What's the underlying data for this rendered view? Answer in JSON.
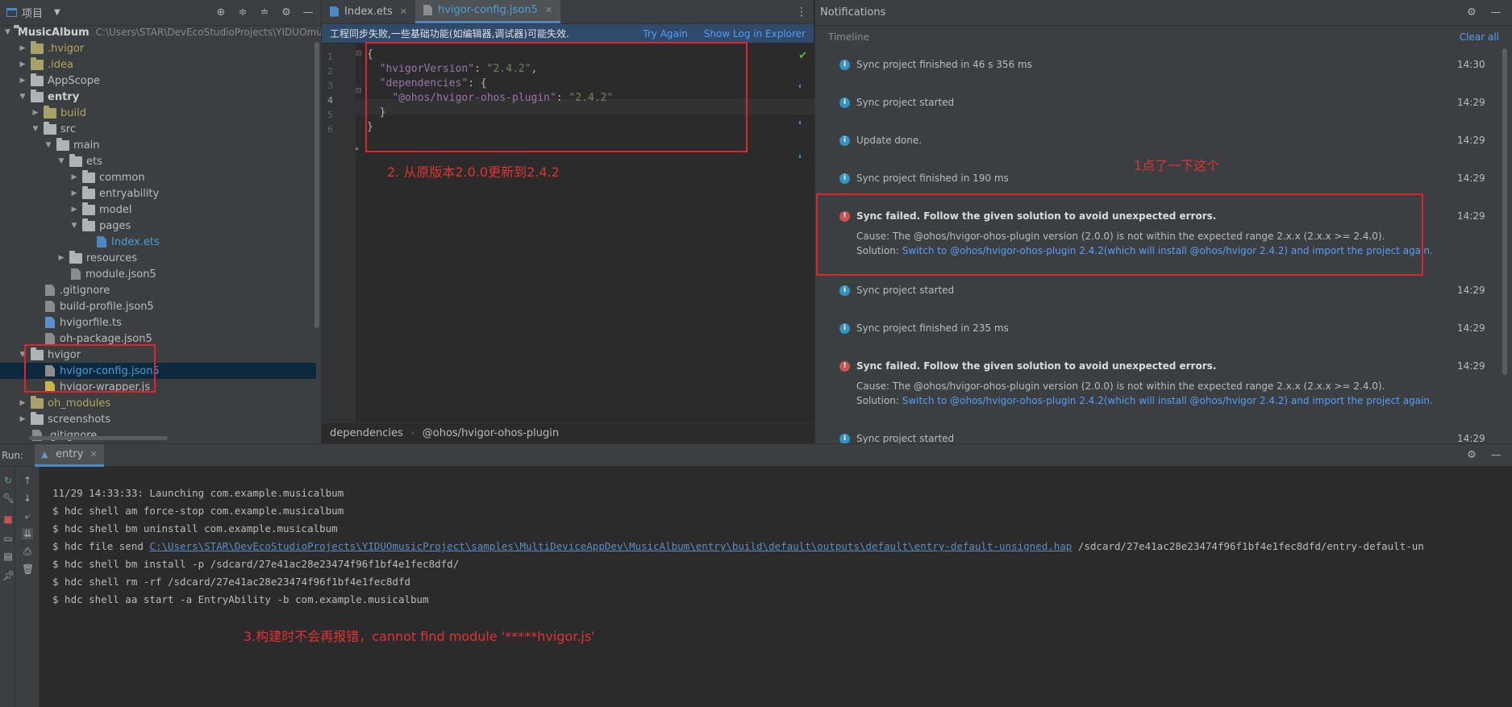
{
  "project": {
    "title": "项目",
    "tree": [
      {
        "label": "MusicAlbum",
        "path": "C:\\Users\\STAR\\DevEcoStudioProjects\\YIDUOmu",
        "indent": 0,
        "arrow": "open",
        "kind": "folder",
        "bold": true
      },
      {
        "label": ".hvigor",
        "indent": 1,
        "arrow": "closed",
        "kind": "folder-yel",
        "color": "yel"
      },
      {
        "label": ".idea",
        "indent": 1,
        "arrow": "closed",
        "kind": "folder-yel",
        "color": "yel"
      },
      {
        "label": "AppScope",
        "indent": 1,
        "arrow": "closed",
        "kind": "folder"
      },
      {
        "label": "entry",
        "indent": 1,
        "arrow": "open",
        "kind": "folder",
        "bold": true
      },
      {
        "label": "build",
        "indent": 2,
        "arrow": "closed",
        "kind": "folder-yel",
        "color": "yel"
      },
      {
        "label": "src",
        "indent": 2,
        "arrow": "open",
        "kind": "folder"
      },
      {
        "label": "main",
        "indent": 3,
        "arrow": "open",
        "kind": "folder"
      },
      {
        "label": "ets",
        "indent": 4,
        "arrow": "open",
        "kind": "folder"
      },
      {
        "label": "common",
        "indent": 5,
        "arrow": "closed",
        "kind": "folder"
      },
      {
        "label": "entryability",
        "indent": 5,
        "arrow": "closed",
        "kind": "folder"
      },
      {
        "label": "model",
        "indent": 5,
        "arrow": "closed",
        "kind": "folder"
      },
      {
        "label": "pages",
        "indent": 5,
        "arrow": "open",
        "kind": "folder"
      },
      {
        "label": "Index.ets",
        "indent": 6,
        "arrow": "none",
        "kind": "file-ets",
        "color": "blue"
      },
      {
        "label": "resources",
        "indent": 4,
        "arrow": "closed",
        "kind": "folder"
      },
      {
        "label": "module.json5",
        "indent": 4,
        "arrow": "none",
        "kind": "file"
      },
      {
        "label": ".gitignore",
        "indent": 2,
        "arrow": "none",
        "kind": "file"
      },
      {
        "label": "build-profile.json5",
        "indent": 2,
        "arrow": "none",
        "kind": "file"
      },
      {
        "label": "hvigorfile.ts",
        "indent": 2,
        "arrow": "none",
        "kind": "file-ts"
      },
      {
        "label": "oh-package.json5",
        "indent": 2,
        "arrow": "none",
        "kind": "file"
      },
      {
        "label": "hvigor",
        "indent": 1,
        "arrow": "open",
        "kind": "folder"
      },
      {
        "label": "hvigor-config.json5",
        "indent": 2,
        "arrow": "none",
        "kind": "file",
        "color": "blue",
        "selected": true
      },
      {
        "label": "hvigor-wrapper.js",
        "indent": 2,
        "arrow": "none",
        "kind": "file-js"
      },
      {
        "label": "oh_modules",
        "indent": 1,
        "arrow": "closed",
        "kind": "folder-yel",
        "color": "yel"
      },
      {
        "label": "screenshots",
        "indent": 1,
        "arrow": "closed",
        "kind": "folder"
      },
      {
        "label": ".gitignore",
        "indent": 1,
        "arrow": "none",
        "kind": "file"
      }
    ]
  },
  "editor": {
    "tabs": [
      {
        "label": "Index.ets",
        "active": false,
        "icon": "ets-file-icon"
      },
      {
        "label": "hvigor-config.json5",
        "active": true,
        "icon": "json-file-icon"
      }
    ],
    "banner": {
      "message": "工程同步失败,一些基础功能(如编辑器,调试器)可能失效.",
      "try_again": "Try Again",
      "show_log": "Show Log in Explorer"
    },
    "line_numbers": [
      "1",
      "2",
      "3",
      "4",
      "5",
      "6"
    ],
    "code": [
      {
        "parts": [
          {
            "t": "{",
            "c": "brace"
          }
        ]
      },
      {
        "parts": [
          {
            "t": "  ",
            "c": ""
          },
          {
            "t": "\"hvigorVersion\"",
            "c": "k"
          },
          {
            "t": ": ",
            "c": ""
          },
          {
            "t": "\"2.4.2\"",
            "c": "s"
          },
          {
            "t": ",",
            "c": ""
          }
        ]
      },
      {
        "parts": [
          {
            "t": "  ",
            "c": ""
          },
          {
            "t": "\"dependencies\"",
            "c": "k"
          },
          {
            "t": ": {",
            "c": ""
          }
        ]
      },
      {
        "parts": [
          {
            "t": "    ",
            "c": ""
          },
          {
            "t": "\"@ohos/hvigor-ohos-plugin\"",
            "c": "k"
          },
          {
            "t": ": ",
            "c": ""
          },
          {
            "t": "\"2.4.2\"",
            "c": "s"
          }
        ]
      },
      {
        "parts": [
          {
            "t": "  }",
            "c": ""
          }
        ]
      },
      {
        "parts": [
          {
            "t": "}",
            "c": "brace"
          }
        ]
      }
    ],
    "breadcrumb": [
      "dependencies",
      "@ohos/hvigor-ohos-plugin"
    ]
  },
  "notifications": {
    "title": "Notifications",
    "timeline": "Timeline",
    "clear_all": "Clear all",
    "events": [
      {
        "type": "info",
        "message": "Sync project finished in 46 s 356 ms",
        "time": "14:30"
      },
      {
        "type": "info",
        "message": "Sync project started",
        "time": "14:29"
      },
      {
        "type": "info",
        "message": "Update done.",
        "time": "14:29"
      },
      {
        "type": "info",
        "message": "Sync project finished in 190 ms",
        "time": "14:29"
      },
      {
        "type": "error",
        "message": "Sync failed. Follow the given solution to avoid unexpected errors.",
        "time": "14:29",
        "cause": "Cause: The @ohos/hvigor-ohos-plugin version (2.0.0) is not within the expected range 2.x.x (2.x.x >= 2.4.0).",
        "solution_label": "Solution: ",
        "solution_link": "Switch to @ohos/hvigor-ohos-plugin 2.4.2(which will install @ohos/hvigor 2.4.2) and import the project again."
      },
      {
        "type": "info",
        "message": "Sync project started",
        "time": "14:29"
      },
      {
        "type": "info",
        "message": "Sync project finished in 235 ms",
        "time": "14:29"
      },
      {
        "type": "error",
        "message": "Sync failed. Follow the given solution to avoid unexpected errors.",
        "time": "14:29",
        "cause": "Cause: The @ohos/hvigor-ohos-plugin version (2.0.0) is not within the expected range 2.x.x (2.x.x >= 2.4.0).",
        "solution_label": "Solution: ",
        "solution_link": "Switch to @ohos/hvigor-ohos-plugin 2.4.2(which will install @ohos/hvigor 2.4.2) and import the project again."
      },
      {
        "type": "info",
        "message": "Sync project started",
        "time": "14:29"
      }
    ]
  },
  "run": {
    "label": "Run:",
    "tab": "entry",
    "console": [
      {
        "text": "11/29 14:33:33: Launching com.example.musicalbum"
      },
      {
        "text": "$ hdc shell am force-stop com.example.musicalbum"
      },
      {
        "text": "$ hdc shell bm uninstall com.example.musicalbum"
      },
      {
        "prefix": "$ hdc file send ",
        "link": "C:\\Users\\STAR\\DevEcoStudioProjects\\YIDUOmusicProject\\samples\\MultiDeviceAppDev\\MusicAlbum\\entry\\build\\default\\outputs\\default\\entry-default-unsigned.hap",
        "suffix": " /sdcard/27e41ac28e23474f96f1bf4e1fec8dfd/entry-default-un"
      },
      {
        "text": "$ hdc shell bm install -p /sdcard/27e41ac28e23474f96f1bf4e1fec8dfd/"
      },
      {
        "text": "$ hdc shell rm -rf /sdcard/27e41ac28e23474f96f1bf4e1fec8dfd"
      },
      {
        "text": "$ hdc shell aa start -a EntryAbility -b com.example.musicalbum"
      }
    ]
  },
  "annotations": {
    "step1": "1点了一下这个",
    "step2": "2. 从原版本2.0.0更新到2.4.2",
    "step3": "3.构建时不会再报错，cannot find module '*****hvigor.js'"
  }
}
